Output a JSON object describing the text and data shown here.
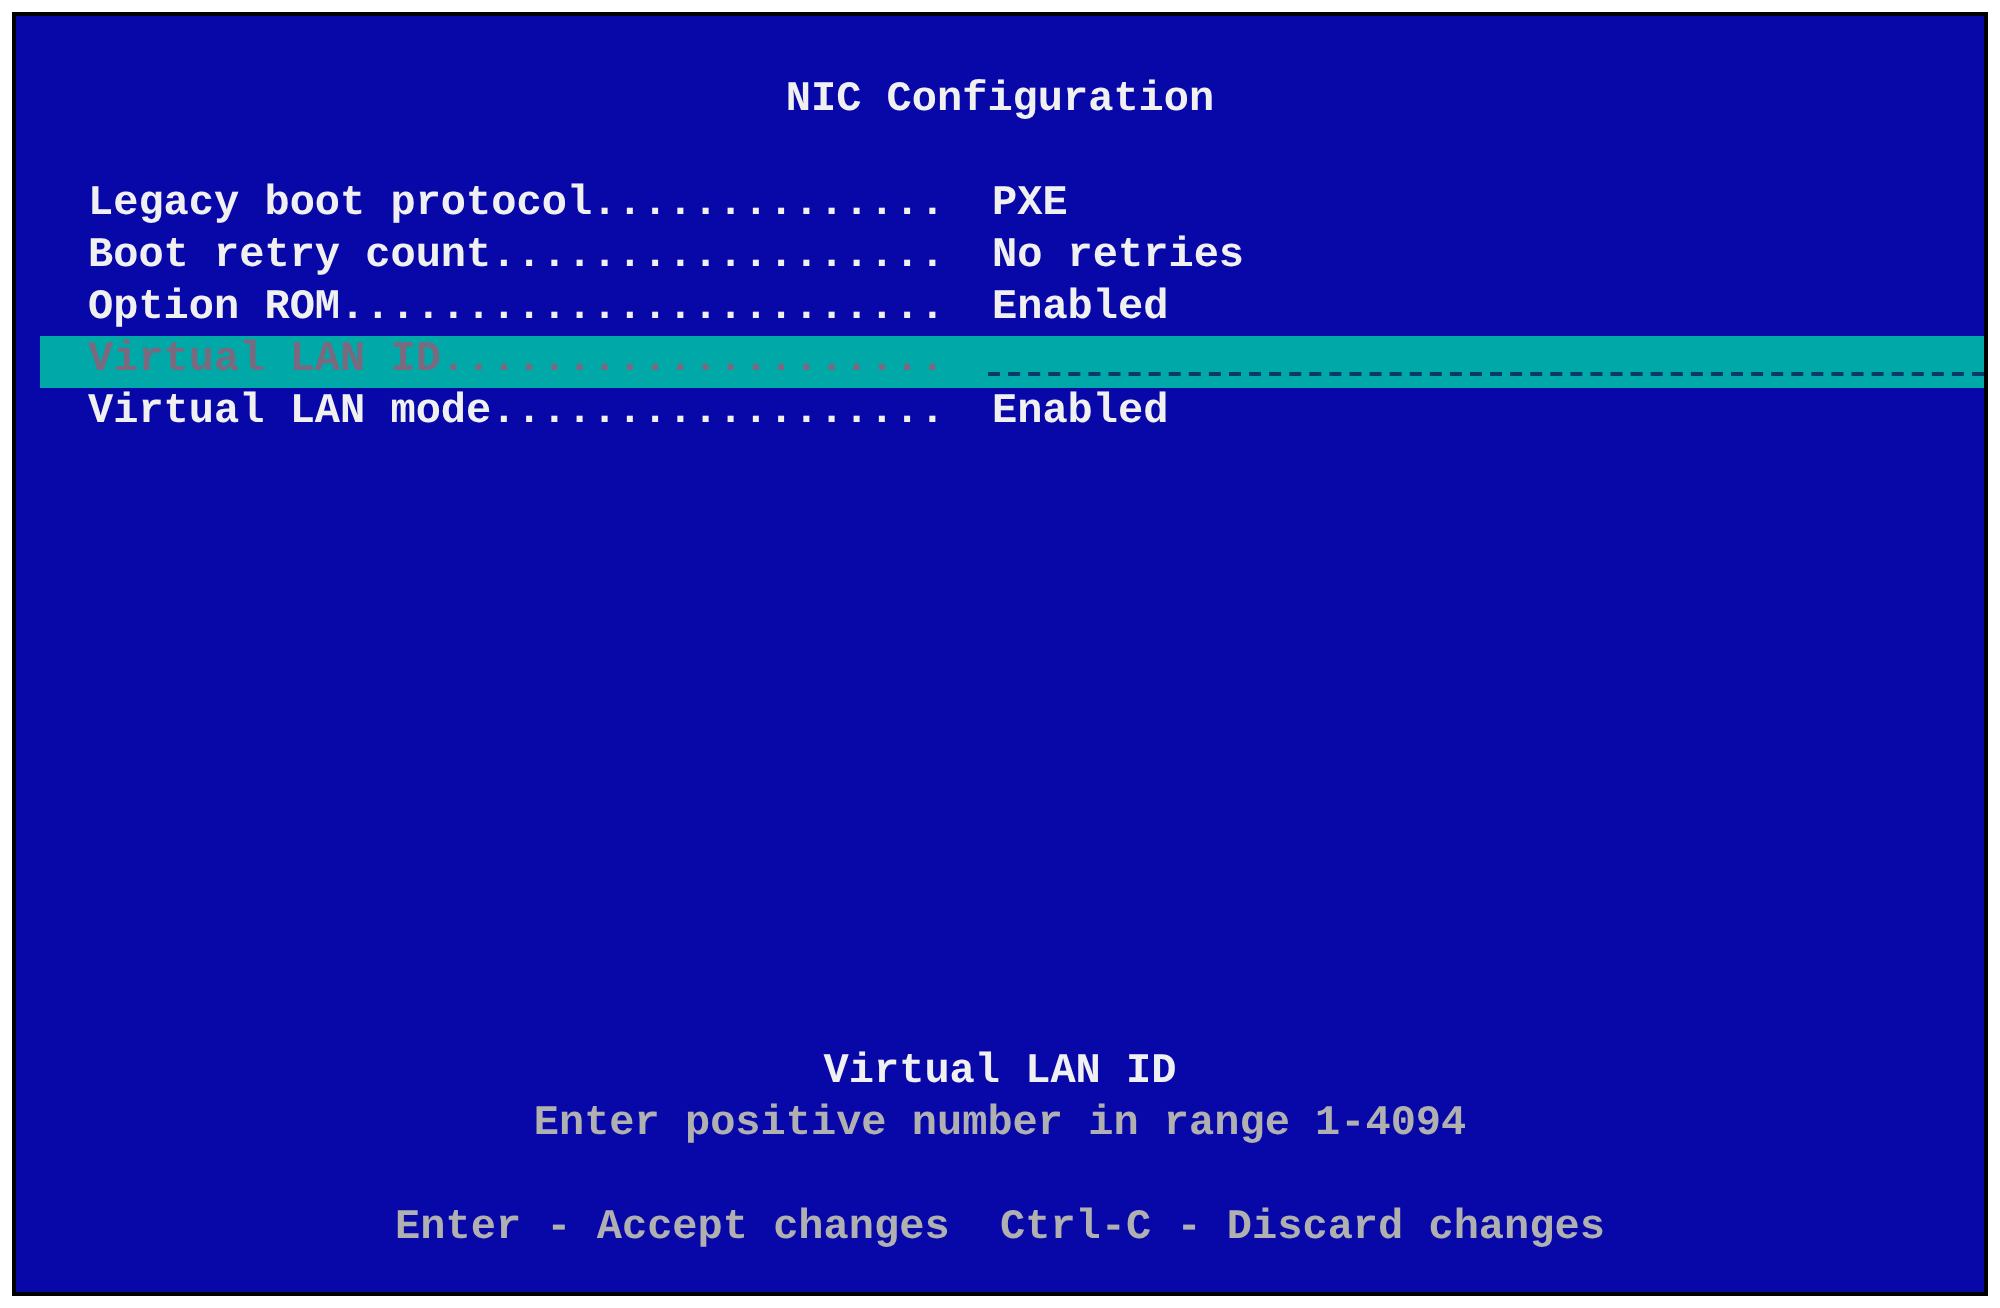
{
  "title": "NIC Configuration",
  "settings": [
    {
      "label": "Legacy boot protocol..............",
      "value": "PXE",
      "kind": "choice",
      "selected": false
    },
    {
      "label": "Boot retry count..................",
      "value": "No retries",
      "kind": "choice",
      "selected": false
    },
    {
      "label": "Option ROM........................",
      "value": "Enabled",
      "kind": "choice",
      "selected": false
    },
    {
      "label": "Virtual LAN ID....................",
      "kind": "entry",
      "selected": true
    },
    {
      "label": "Virtual LAN mode..................",
      "value": "Enabled",
      "kind": "choice",
      "selected": false
    }
  ],
  "help": {
    "title": "Virtual LAN ID",
    "text": "Enter positive number in range 1-4094"
  },
  "keys": "Enter - Accept changes  Ctrl-C - Discard changes"
}
